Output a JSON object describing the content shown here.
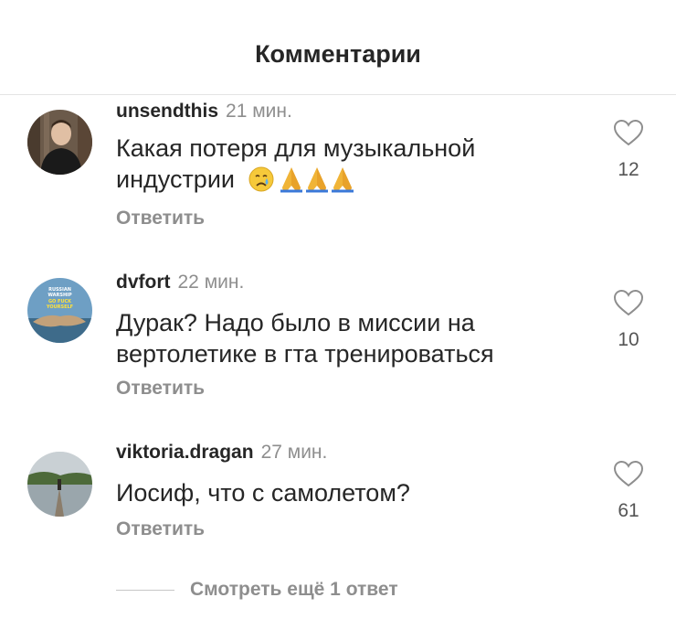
{
  "header": {
    "title": "Комментарии"
  },
  "comments": [
    {
      "username": "unsendthis",
      "time": "21 мин.",
      "text": "Какая потеря для музыкальной индустрии",
      "emojis": [
        "crying-face",
        "folded-hands",
        "folded-hands",
        "folded-hands"
      ],
      "reply_label": "Ответить",
      "likes": "12"
    },
    {
      "username": "dvfort",
      "time": "22 мин.",
      "text": "Дурак? Надо было в миссии на вертолетике в гта тренироваться",
      "avatar_text": [
        "RUSSIAN",
        "WARSHIP",
        "GO FUCK",
        "YOURSELF"
      ],
      "reply_label": "Ответить",
      "likes": "10"
    },
    {
      "username": "viktoria.dragan",
      "time": "27 мин.",
      "text": "Иосиф, что с самолетом?",
      "reply_label": "Ответить",
      "likes": "61"
    }
  ],
  "footer": {
    "more_replies": "Смотреть ещё 1 ответ"
  },
  "colors": {
    "text": "#262626",
    "secondary": "#8e8e8e",
    "divider": "#e4e4e4"
  }
}
